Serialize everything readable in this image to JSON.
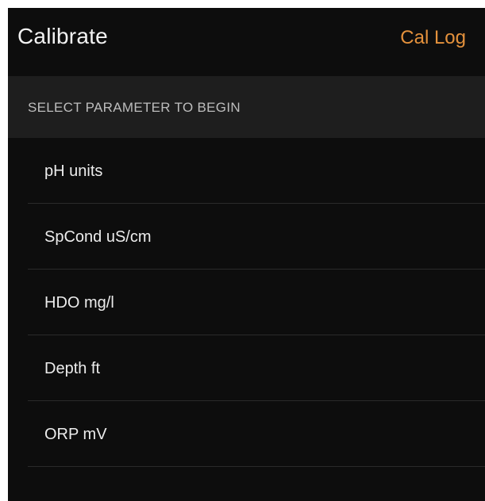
{
  "header": {
    "title": "Calibrate",
    "action_label": "Cal Log"
  },
  "section": {
    "label": "SELECT PARAMETER TO BEGIN"
  },
  "parameters": [
    {
      "label": "pH units"
    },
    {
      "label": "SpCond uS/cm"
    },
    {
      "label": "HDO mg/l"
    },
    {
      "label": "Depth ft"
    },
    {
      "label": "ORP mV"
    }
  ],
  "colors": {
    "background": "#0d0d0d",
    "section_background": "#1e1e1e",
    "accent": "#e4913c",
    "text": "#ececec"
  }
}
